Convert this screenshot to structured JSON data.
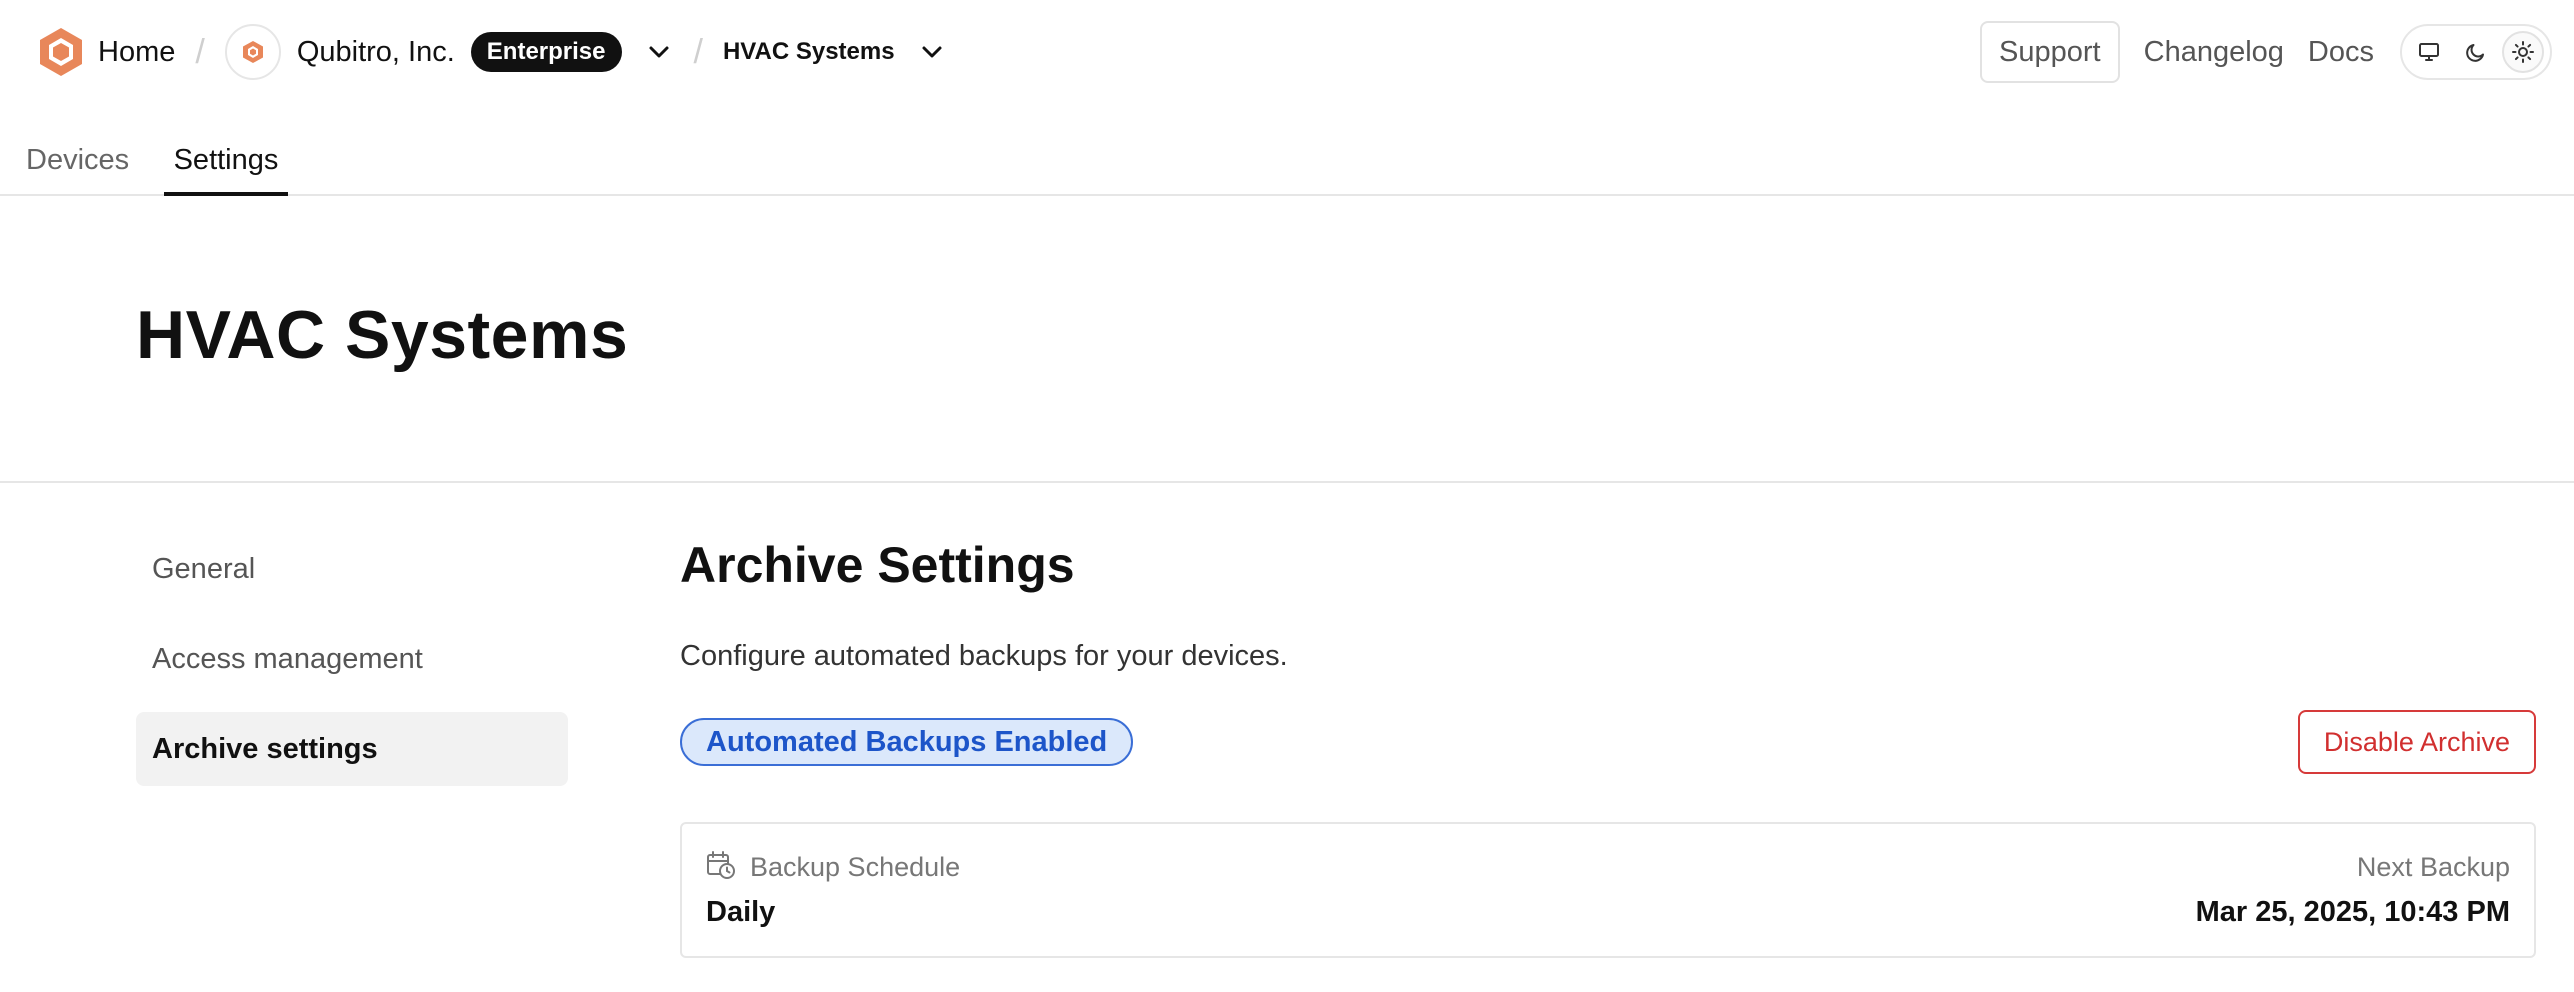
{
  "breadcrumb": {
    "home_label": "Home",
    "org_name": "Qubitro, Inc.",
    "org_plan_badge": "Enterprise",
    "project_name": "HVAC Systems"
  },
  "header_links": {
    "support": "Support",
    "changelog": "Changelog",
    "docs": "Docs"
  },
  "theme_switcher": {
    "options": [
      "system",
      "dark",
      "light"
    ],
    "active": "light"
  },
  "tabs": [
    {
      "label": "Devices",
      "active": false
    },
    {
      "label": "Settings",
      "active": true
    }
  ],
  "page": {
    "title": "HVAC Systems"
  },
  "side_nav": {
    "items": [
      {
        "label": "General",
        "active": false
      },
      {
        "label": "Access management",
        "active": false
      },
      {
        "label": "Archive settings",
        "active": true
      }
    ]
  },
  "archive": {
    "title": "Archive Settings",
    "description": "Configure automated backups for your devices.",
    "status_badge": "Automated Backups Enabled",
    "disable_button": "Disable Archive",
    "schedule_label": "Backup Schedule",
    "schedule_value": "Daily",
    "next_backup_label": "Next Backup",
    "next_backup_value": "Mar 25, 2025, 10:43 PM"
  },
  "colors": {
    "brand_orange": "#E8875A",
    "status_blue": "#1D55C9",
    "danger_red": "#D12F2F"
  }
}
